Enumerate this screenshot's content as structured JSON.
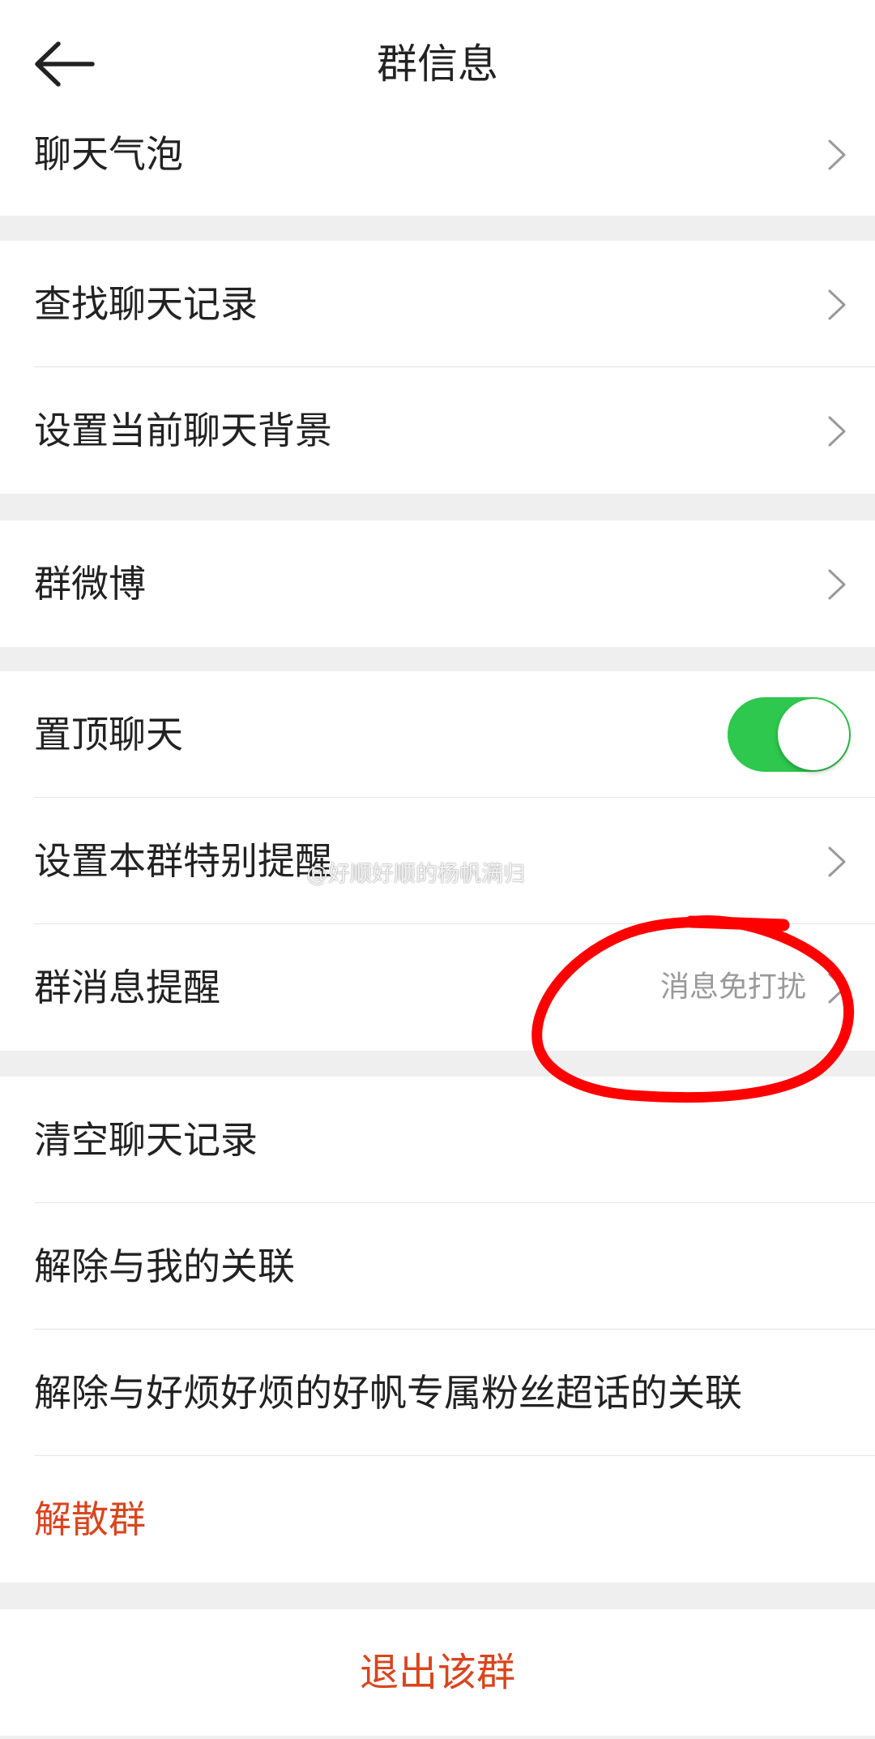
{
  "header": {
    "title": "群信息"
  },
  "sections": [
    {
      "items": [
        {
          "label": "聊天气泡"
        }
      ]
    },
    {
      "items": [
        {
          "label": "查找聊天记录"
        },
        {
          "label": "设置当前聊天背景"
        }
      ]
    },
    {
      "items": [
        {
          "label": "群微博"
        }
      ]
    },
    {
      "items": [
        {
          "label": "置顶聊天",
          "toggle_on": true
        },
        {
          "label": "设置本群特别提醒"
        },
        {
          "label": "群消息提醒",
          "value": "消息免打扰"
        }
      ]
    },
    {
      "items": [
        {
          "label": "清空聊天记录"
        },
        {
          "label": "解除与我的关联"
        },
        {
          "label": "解除与好烦好烦的好帆专属粉丝超话的关联"
        },
        {
          "label": "解散群"
        }
      ]
    }
  ],
  "footer": {
    "quit_label": "退出该群"
  },
  "watermark": "@好顺好顺的杨帆满归",
  "colors": {
    "toggle_on": "#2dc84d",
    "danger": "#d9451e",
    "annotation": "#ff0000"
  }
}
